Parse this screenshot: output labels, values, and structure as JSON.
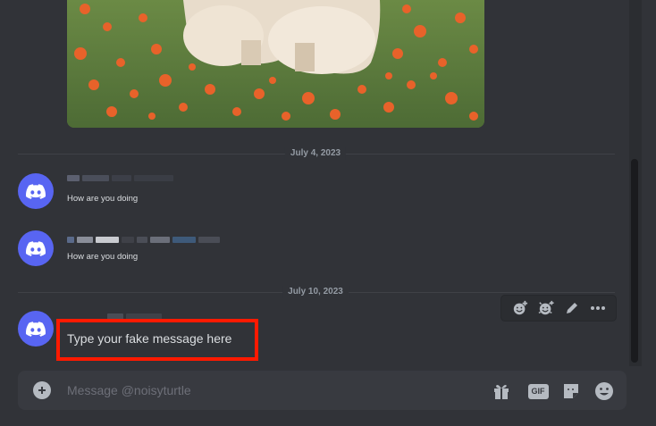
{
  "channel": {
    "composer_placeholder": "Message @noisyturtle"
  },
  "dividers": [
    {
      "label": "July 4, 2023"
    },
    {
      "label": "July 10, 2023"
    }
  ],
  "messages": [
    {
      "text": "How are you doing"
    },
    {
      "text": "How are you doing"
    },
    {
      "text": "Type your fake message here"
    }
  ],
  "hover_toolbar": {
    "icons": [
      "add-reaction-icon",
      "super-reaction-icon",
      "edit-icon",
      "more-options-icon"
    ]
  },
  "composer_icons": {
    "gif_label": "GIF",
    "icons": [
      "gift-icon",
      "gif-icon",
      "sticker-icon",
      "emoji-icon"
    ]
  },
  "colors": {
    "background": "#313338",
    "avatar": "#5865f2",
    "highlight_border": "#ff1a00",
    "composer": "#383a40"
  }
}
